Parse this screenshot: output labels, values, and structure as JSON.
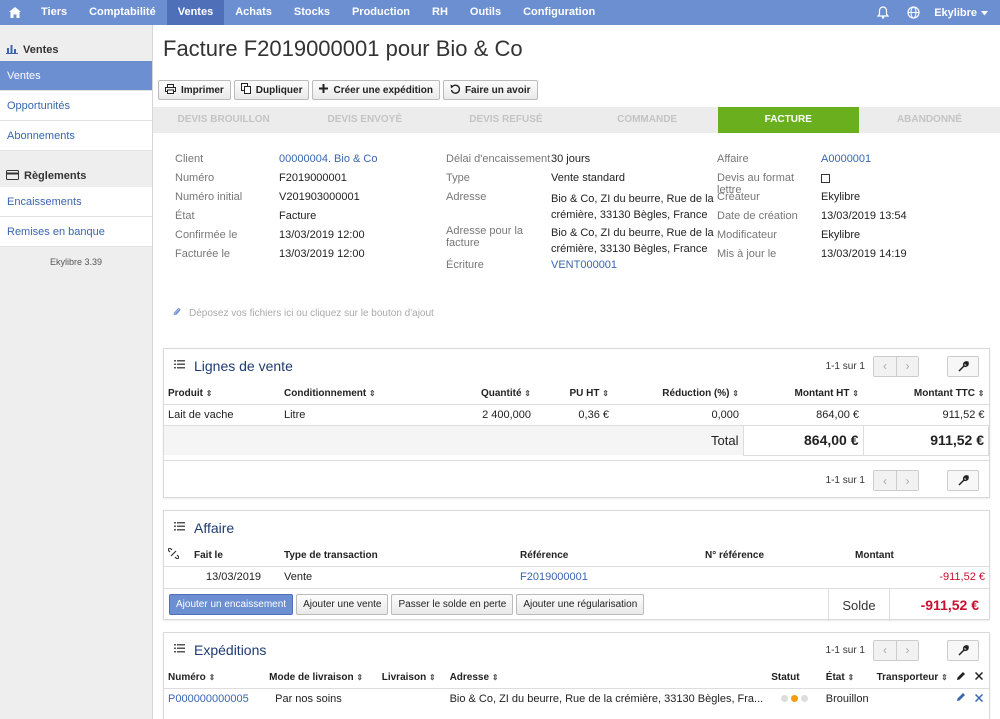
{
  "nav": {
    "items": [
      "Tiers",
      "Comptabilité",
      "Ventes",
      "Achats",
      "Stocks",
      "Production",
      "RH",
      "Outils",
      "Configuration"
    ],
    "active": "Ventes",
    "user": "Ekylibre"
  },
  "sidebar": {
    "section1": "Ventes",
    "items1": [
      "Ventes",
      "Opportunités",
      "Abonnements"
    ],
    "section2": "Règlements",
    "items2": [
      "Encaissements",
      "Remises en banque"
    ],
    "version": "Ekylibre 3.39"
  },
  "page": {
    "title": "Facture F2019000001 pour Bio & Co"
  },
  "toolbar": {
    "print": "Imprimer",
    "duplicate": "Dupliquer",
    "shipment": "Créer une expédition",
    "credit": "Faire un avoir"
  },
  "steps": [
    "DEVIS BROUILLON",
    "DEVIS ENVOYÉ",
    "DEVIS REFUSÉ",
    "COMMANDE",
    "FACTURE",
    "ABANDONNÉ"
  ],
  "info": {
    "col1": [
      {
        "label": "Client",
        "value": "00000004. Bio & Co",
        "link": true
      },
      {
        "label": "Numéro",
        "value": "F2019000001"
      },
      {
        "label": "Numéro initial",
        "value": "V201903000001"
      },
      {
        "label": "État",
        "value": "Facture"
      },
      {
        "label": "Confirmée le",
        "value": "13/03/2019 12:00"
      },
      {
        "label": "Facturée le",
        "value": "13/03/2019 12:00"
      }
    ],
    "col2": [
      {
        "label": "Délai d'encaissement",
        "value": "30 jours"
      },
      {
        "label": "Type",
        "value": "Vente standard"
      },
      {
        "label": "Adresse",
        "value": "Bio & Co, ZI du beurre, Rue de la",
        "value2": "crémière, 33130 Bègles, France"
      },
      {
        "label": "Adresse pour la facture",
        "value": "Bio & Co, ZI du beurre, Rue de la",
        "value2": "crémière, 33130 Bègles, France"
      },
      {
        "label": "Écriture",
        "value": "VENT000001",
        "link": true
      }
    ],
    "col3": [
      {
        "label": "Affaire",
        "value": "A0000001",
        "link": true
      },
      {
        "label": "Devis au format lettre",
        "value": ""
      },
      {
        "label": "Créateur",
        "value": "Ekylibre"
      },
      {
        "label": "Date de création",
        "value": "13/03/2019 13:54"
      },
      {
        "label": "Modificateur",
        "value": "Ekylibre"
      },
      {
        "label": "Mis à jour le",
        "value": "13/03/2019 14:19"
      }
    ]
  },
  "dropzone": "Déposez vos fichiers ici ou cliquez sur le bouton d'ajout",
  "lines": {
    "title": "Lignes de vente",
    "pager": "1-1 sur 1",
    "headers": [
      "Produit",
      "Conditionnement",
      "Quantité",
      "PU HT",
      "Réduction (%)",
      "Montant HT",
      "Montant TTC"
    ],
    "rows": [
      [
        "Lait de vache",
        "Litre",
        "2 400,000",
        "0,36 €",
        "0,000",
        "864,00 €",
        "911,52 €"
      ]
    ],
    "total_label": "Total",
    "total_ht": "864,00 €",
    "total_ttc": "911,52 €"
  },
  "affair": {
    "title": "Affaire",
    "headers": [
      "Fait le",
      "Type de transaction",
      "Référence",
      "N° référence",
      "Montant"
    ],
    "rows": [
      [
        "13/03/2019",
        "Vente",
        "F2019000001",
        "",
        "-911,52 €"
      ]
    ],
    "buttons": [
      "Ajouter un encaissement",
      "Ajouter une vente",
      "Passer le solde en perte",
      "Ajouter une régularisation"
    ],
    "balance_label": "Solde",
    "balance": "-911,52 €"
  },
  "shipments": {
    "title": "Expéditions",
    "pager": "1-1 sur 1",
    "headers": [
      "Numéro",
      "Mode de livraison",
      "Livraison",
      "Adresse",
      "Statut",
      "État",
      "Transporteur"
    ],
    "rows": [
      [
        "P000000000005",
        "Par nos soins",
        "",
        "Bio & Co, ZI du beurre, Rue de la crémière, 33130 Bègles, Fra...",
        "",
        "Brouillon",
        ""
      ]
    ]
  },
  "colors": {
    "nav": "#6b8fd1",
    "active_step": "#6ab01e",
    "link": "#3a66b0",
    "negative": "#c8102e"
  }
}
